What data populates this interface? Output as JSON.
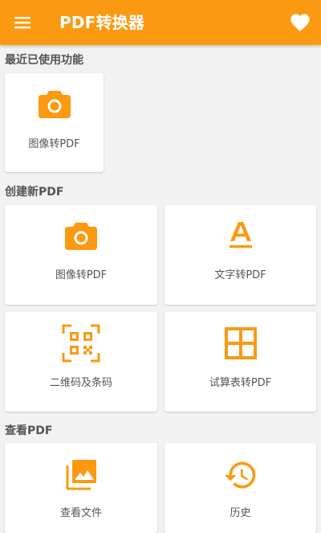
{
  "app": {
    "title": "PDF转换器",
    "accent_color": "#fb9a10",
    "menu_icon": "hamburger-menu-icon",
    "favorite_icon": "heart-icon"
  },
  "sections": {
    "recent": {
      "title": "最近已使用功能",
      "items": [
        {
          "label": "图像转PDF",
          "icon": "camera-icon"
        }
      ]
    },
    "create": {
      "title": "创建新PDF",
      "items": [
        {
          "label": "图像转PDF",
          "icon": "camera-icon"
        },
        {
          "label": "文字转PDF",
          "icon": "text-format-icon"
        },
        {
          "label": "二维码及条码",
          "icon": "qr-code-scan-icon"
        },
        {
          "label": "试算表转PDF",
          "icon": "spreadsheet-grid-icon"
        }
      ]
    },
    "view": {
      "title": "查看PDF",
      "items": [
        {
          "label": "查看文件",
          "icon": "gallery-icon"
        },
        {
          "label": "历史",
          "icon": "history-icon"
        }
      ]
    }
  }
}
